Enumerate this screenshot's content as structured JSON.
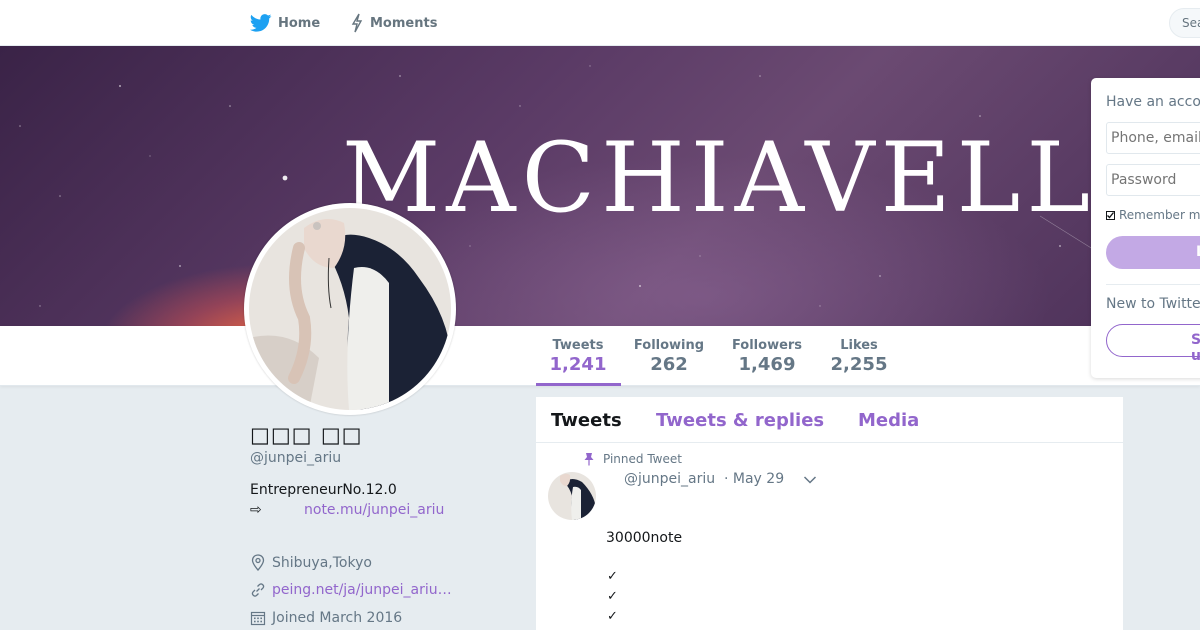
{
  "nav": {
    "home_label": "Home",
    "moments_label": "Moments",
    "search_placeholder": "Sea",
    "have_account_hint": "Ha"
  },
  "banner": {
    "text": "MACHIAVELLI"
  },
  "stats": {
    "tweets": {
      "label": "Tweets",
      "value": "1,241"
    },
    "following": {
      "label": "Following",
      "value": "262"
    },
    "followers": {
      "label": "Followers",
      "value": "1,469"
    },
    "likes": {
      "label": "Likes",
      "value": "2,255"
    }
  },
  "profile": {
    "name": "□□□ □□",
    "handle": "@junpei_ariu",
    "bio_line1": "EntrepreneurNo.12.0",
    "bio_arrow": "⇨",
    "bio_link": "note.mu/junpei_ariu",
    "location": "Shibuya,Tokyo",
    "url": "peing.net/ja/junpei_ariu…",
    "joined": "Joined March 2016"
  },
  "timeline": {
    "tabs": [
      "Tweets",
      "Tweets & replies",
      "Media"
    ],
    "pinned_label": "Pinned Tweet",
    "tweet": {
      "handle": "@junpei_ariu",
      "date": "· May 29",
      "text": "30000note",
      "checks": [
        "✓",
        "✓",
        "✓"
      ]
    }
  },
  "login": {
    "heading": "Have an account?",
    "phone_placeholder": "Phone, email",
    "password_placeholder": "Password",
    "remember_label": "Remember me",
    "login_button": "Log in",
    "new_heading": "New to Twitter?",
    "signup_button": "Sign up"
  },
  "colors": {
    "accent": "#9266cc",
    "text_primary": "#14171a",
    "text_secondary": "#657786",
    "background": "#e6ecf0",
    "twitter_blue": "#1da1f2"
  },
  "icons": {
    "home": "twitter-bird-icon",
    "moments": "lightning-icon",
    "location": "location-pin-icon",
    "url": "link-icon",
    "joined": "calendar-icon",
    "pinned": "pin-icon",
    "caret": "chevron-down-icon"
  }
}
